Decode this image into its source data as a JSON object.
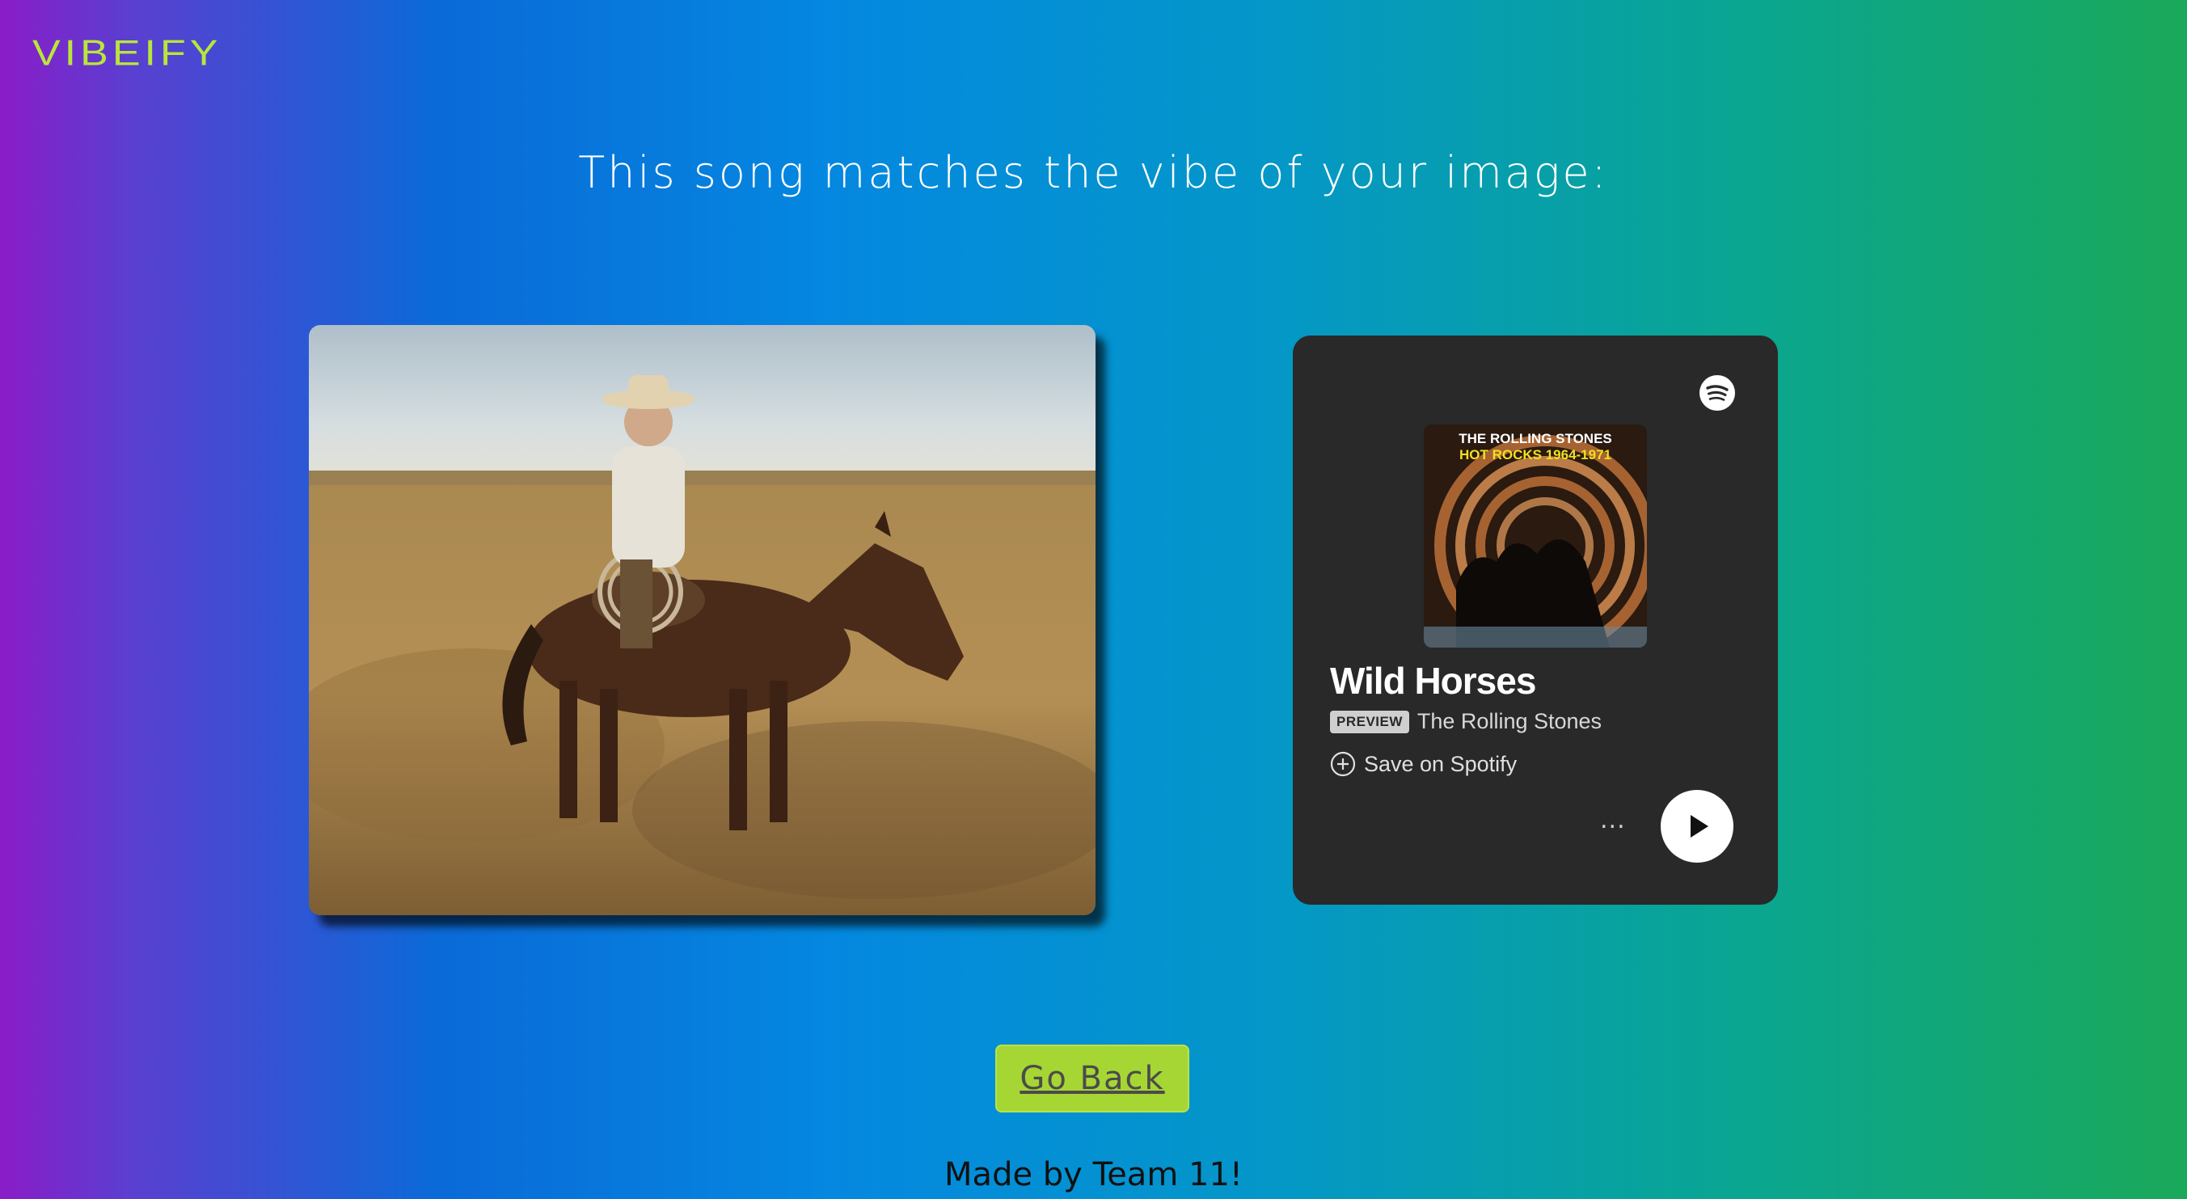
{
  "app": {
    "logo": "VIBEIFY"
  },
  "headline": "This song matches the vibe of your image:",
  "image": {
    "alt_icon": "photo-cowboy-on-horse-icon"
  },
  "player": {
    "album_line1": "THE ROLLING STONES",
    "album_line2": "HOT ROCKS 1964-1971",
    "song_title": "Wild Horses",
    "badge": "PREVIEW",
    "artist": "The Rolling Stones",
    "save_label": "Save on Spotify",
    "more_label": "...",
    "icons": {
      "brand": "spotify-icon",
      "save": "plus-circle-icon",
      "play": "play-icon"
    }
  },
  "go_back_label": "Go Back",
  "footer": "Made by Team 11!",
  "colors": {
    "logo": "#b9e63a",
    "button": "#a6d634",
    "player_bg": "#292929"
  }
}
